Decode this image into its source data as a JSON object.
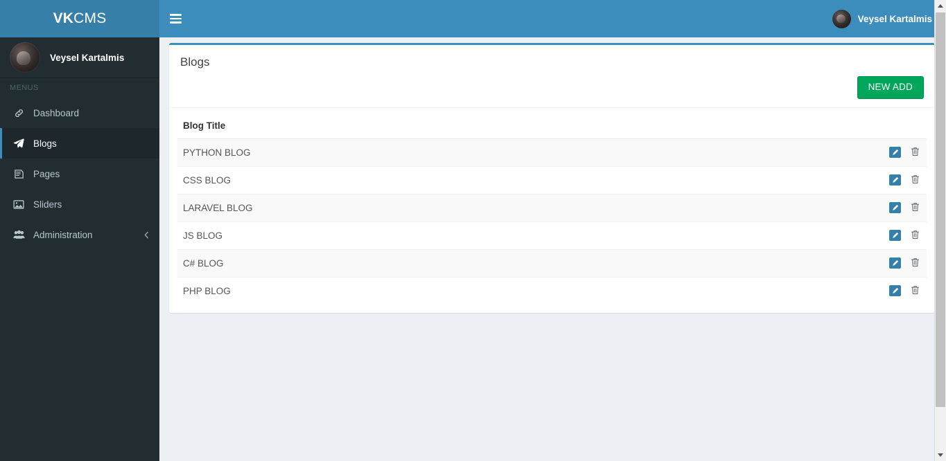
{
  "app": {
    "brand_bold": "VK",
    "brand_light": "CMS"
  },
  "sidebar": {
    "user": {
      "name": "Veysel Kartalmis",
      "avatar": "user-avatar"
    },
    "menu_header": "MENUS",
    "items": [
      {
        "label": "Dashboard",
        "icon": "link-icon",
        "active": false,
        "has_arrow": false
      },
      {
        "label": "Blogs",
        "icon": "paper-plane-icon",
        "active": true,
        "has_arrow": false
      },
      {
        "label": "Pages",
        "icon": "file-text-icon",
        "active": false,
        "has_arrow": false
      },
      {
        "label": "Sliders",
        "icon": "image-icon",
        "active": false,
        "has_arrow": false
      },
      {
        "label": "Administration",
        "icon": "users-icon",
        "active": false,
        "has_arrow": true,
        "arrow": "chevron-left-icon"
      }
    ]
  },
  "navbar": {
    "toggle_icon": "hamburger-menu-icon",
    "user_name": "Veysel Kartalmis",
    "avatar": "user-avatar"
  },
  "main": {
    "card_title": "Blogs",
    "new_add_label": "NEW ADD",
    "table": {
      "headers": [
        "Blog Title",
        ""
      ],
      "rows": [
        {
          "title": "PYTHON BLOG",
          "edit_icon": "pencil-icon",
          "delete_icon": "trash-icon"
        },
        {
          "title": "CSS BLOG",
          "edit_icon": "pencil-icon",
          "delete_icon": "trash-icon"
        },
        {
          "title": "LARAVEL BLOG",
          "edit_icon": "pencil-icon",
          "delete_icon": "trash-icon"
        },
        {
          "title": "JS BLOG",
          "edit_icon": "pencil-icon",
          "delete_icon": "trash-icon"
        },
        {
          "title": "C# BLOG",
          "edit_icon": "pencil-icon",
          "delete_icon": "trash-icon"
        },
        {
          "title": "PHP BLOG",
          "edit_icon": "pencil-icon",
          "delete_icon": "trash-icon"
        }
      ]
    }
  },
  "colors": {
    "navbar": "#3c8dbc",
    "logo_bar": "#367fa9",
    "sidebar": "#222d32",
    "sidebar_active": "#1e282c",
    "page_bg": "#ecf0f5",
    "success": "#00a65a",
    "edit_blue": "#367fa9"
  }
}
